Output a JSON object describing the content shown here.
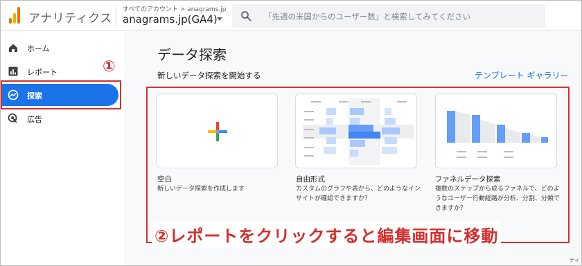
{
  "header": {
    "app_title": "アナリティクス",
    "account_crumb": "すべてのアカウント > anagrams.jp",
    "property": "anagrams.jp(GA4)",
    "search_placeholder": "「先週の米国からのユーザー数」と検索してみてください"
  },
  "sidebar": {
    "items": [
      {
        "label": "ホーム",
        "icon": "home-icon"
      },
      {
        "label": "レポート",
        "icon": "bar-chart-icon"
      },
      {
        "label": "探索",
        "icon": "explore-icon"
      },
      {
        "label": "広告",
        "icon": "ads-icon"
      }
    ]
  },
  "annotations": {
    "step1": "①",
    "step2": "②レポートをクリックすると編集画面に移動"
  },
  "main": {
    "title": "データ探索",
    "section_label": "新しいデータ探索を開始する",
    "gallery_link": "テンプレート ギャラリー",
    "cards": [
      {
        "title": "空白",
        "desc": "新しいデータ探索を作成します"
      },
      {
        "title": "自由形式",
        "desc": "カスタムのグラフや表から、どのようなインサイトが確認できますか？"
      },
      {
        "title": "ファネルデータ探索",
        "desc": "複数のステップから成るファネルで、どのようなユーザー行動経路が分析、分割、分類できますか？"
      }
    ],
    "corner": "ティ"
  },
  "colors": {
    "accent": "#1a73e8",
    "annotation": "#d32f2f"
  }
}
